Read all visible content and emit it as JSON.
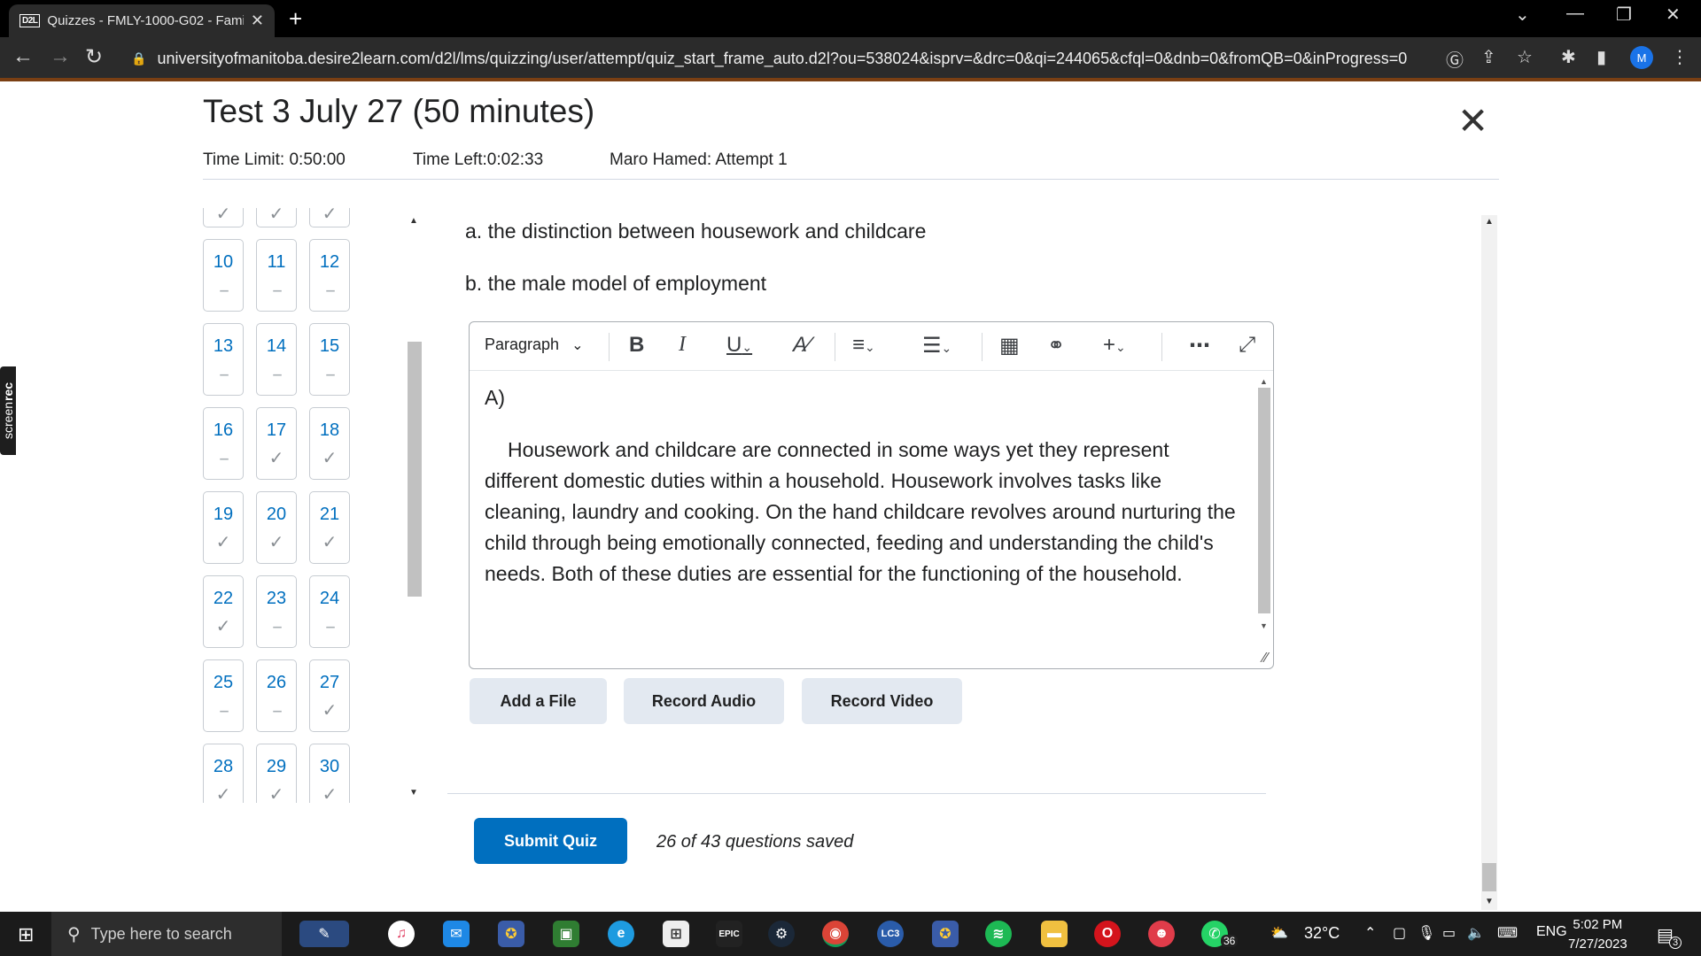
{
  "browser": {
    "tab_favicon": "D2L",
    "tab_title": "Quizzes - FMLY-1000-G02 - Fami",
    "url": "universityofmanitoba.desire2learn.com/d2l/lms/quizzing/user/attempt/quiz_start_frame_auto.d2l?ou=538024&isprv=&drc=0&qi=244065&cfql=0&dnb=0&fromQB=0&inProgress=0",
    "profile_initial": "M"
  },
  "screenrec": {
    "label_light": "screen",
    "label_bold": "rec"
  },
  "quiz": {
    "title": "Test 3 July 27 (50 minutes)",
    "time_limit": "Time Limit: 0:50:00",
    "time_left": "Time Left:0:02:33",
    "attempt": "Maro Hamed: Attempt 1"
  },
  "question_grid": [
    {
      "num": "",
      "status": "saved"
    },
    {
      "num": "",
      "status": "saved"
    },
    {
      "num": "",
      "status": "saved"
    },
    {
      "num": "10",
      "status": "unanswered"
    },
    {
      "num": "11",
      "status": "unanswered"
    },
    {
      "num": "12",
      "status": "unanswered"
    },
    {
      "num": "13",
      "status": "unanswered"
    },
    {
      "num": "14",
      "status": "unanswered"
    },
    {
      "num": "15",
      "status": "unanswered"
    },
    {
      "num": "16",
      "status": "unanswered"
    },
    {
      "num": "17",
      "status": "saved"
    },
    {
      "num": "18",
      "status": "saved"
    },
    {
      "num": "19",
      "status": "saved"
    },
    {
      "num": "20",
      "status": "saved"
    },
    {
      "num": "21",
      "status": "saved"
    },
    {
      "num": "22",
      "status": "saved"
    },
    {
      "num": "23",
      "status": "unanswered"
    },
    {
      "num": "24",
      "status": "unanswered"
    },
    {
      "num": "25",
      "status": "unanswered"
    },
    {
      "num": "26",
      "status": "unanswered"
    },
    {
      "num": "27",
      "status": "saved"
    },
    {
      "num": "28",
      "status": "saved"
    },
    {
      "num": "29",
      "status": "saved"
    },
    {
      "num": "30",
      "status": "saved"
    }
  ],
  "question": {
    "option_a": "a. the distinction between housework and childcare",
    "option_b": "b. the male model of employment"
  },
  "editor": {
    "block_format": "Paragraph",
    "answer_label": "A)",
    "answer_text": "Housework and childcare are connected in some ways yet they represent different domestic duties within a household. Housework involves tasks like cleaning, laundry and cooking. On the hand childcare revolves around nurturing the child through being emotionally connected, feeding and understanding the child's needs. Both of these duties are essential for the functioning of the household.",
    "tools": [
      "bold-icon",
      "italic-icon",
      "underline-icon",
      "format-clear-icon",
      "align-icon",
      "list-icon",
      "insert-stuff-icon",
      "link-icon",
      "insert-plus-icon",
      "more-icon",
      "fullscreen-icon"
    ]
  },
  "actions": {
    "add_file": "Add a File",
    "record_audio": "Record Audio",
    "record_video": "Record Video",
    "submit": "Submit Quiz",
    "saved_status": "26 of 43 questions saved"
  },
  "taskbar": {
    "search_placeholder": "Type here to search",
    "temperature": "32°C",
    "language": "ENG",
    "time": "5:02 PM",
    "date": "7/27/2023",
    "notifications": "3",
    "whatsapp_badge": "36",
    "epic_label": "EPIC"
  },
  "colors": {
    "link_blue": "#006fbf",
    "submit_blue": "#006fbf",
    "secondary_button": "#e3e9f1",
    "accent_bar": "#7a3f13"
  }
}
